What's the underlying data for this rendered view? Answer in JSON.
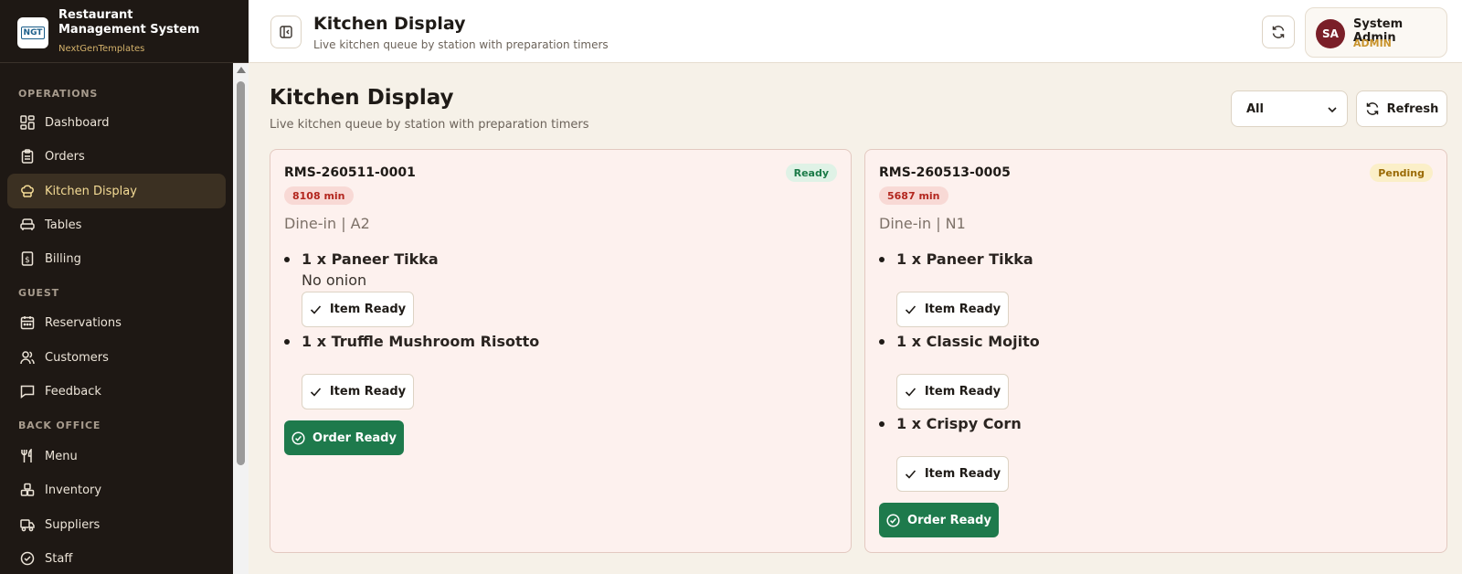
{
  "brand": {
    "logo_text": "NGT",
    "title": "Restaurant Management System",
    "subtitle": "NextGenTemplates"
  },
  "sidebar": {
    "sections": [
      {
        "label": "OPERATIONS"
      },
      {
        "label": "GUEST"
      },
      {
        "label": "BACK OFFICE"
      }
    ],
    "items": [
      {
        "label": "Dashboard",
        "icon": "dashboard-icon"
      },
      {
        "label": "Orders",
        "icon": "clipboard-icon"
      },
      {
        "label": "Kitchen Display",
        "icon": "chef-hat-icon",
        "active": true
      },
      {
        "label": "Tables",
        "icon": "sofa-icon"
      },
      {
        "label": "Billing",
        "icon": "receipt-icon"
      },
      {
        "label": "Reservations",
        "icon": "calendar-icon"
      },
      {
        "label": "Customers",
        "icon": "users-icon"
      },
      {
        "label": "Feedback",
        "icon": "message-icon"
      },
      {
        "label": "Menu",
        "icon": "utensils-icon"
      },
      {
        "label": "Inventory",
        "icon": "boxes-icon"
      },
      {
        "label": "Suppliers",
        "icon": "truck-icon"
      },
      {
        "label": "Staff",
        "icon": "badge-check-icon"
      }
    ]
  },
  "topbar": {
    "title": "Kitchen Display",
    "subtitle": "Live kitchen queue by station with preparation timers",
    "user": {
      "initials": "SA",
      "name": "System Admin",
      "role": "ADMIN"
    }
  },
  "main": {
    "title": "Kitchen Display",
    "subtitle": "Live kitchen queue by station with preparation timers",
    "filter": {
      "selected": "All"
    },
    "refresh_label": "Refresh"
  },
  "orders": [
    {
      "id": "RMS-260511-0001",
      "status": "Ready",
      "timer": "8108 min",
      "dine": "Dine-in | A2",
      "items": [
        {
          "name": "1 x Paneer Tikka",
          "note": "No onion",
          "button": "Item Ready"
        },
        {
          "name": "1 x Truffle Mushroom Risotto",
          "note": "",
          "button": "Item Ready"
        }
      ],
      "order_ready_label": "Order Ready"
    },
    {
      "id": "RMS-260513-0005",
      "status": "Pending",
      "timer": "5687 min",
      "dine": "Dine-in | N1",
      "items": [
        {
          "name": "1 x Paneer Tikka",
          "note": "",
          "button": "Item Ready"
        },
        {
          "name": "1 x Classic Mojito",
          "note": "",
          "button": "Item Ready"
        },
        {
          "name": "1 x Crispy Corn",
          "note": "",
          "button": "Item Ready"
        }
      ],
      "order_ready_label": "Order Ready"
    }
  ],
  "colors": {
    "sidebar_bg": "#1e1814",
    "accent_gold": "#d4b26b",
    "success_green": "#1e7a4c",
    "timer_red": "#b3261e",
    "avatar_bg": "#7a1f28"
  }
}
